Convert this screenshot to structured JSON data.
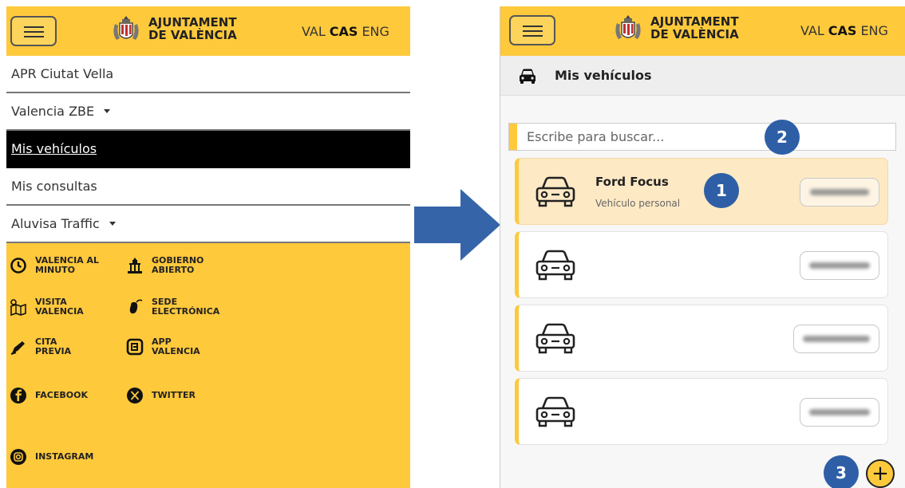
{
  "left": {
    "header": {
      "logo_line1": "AJUNTAMENT",
      "logo_line2": "DE VALÈNCIA",
      "languages": [
        "VAL",
        "CAS",
        "ENG"
      ],
      "active_language": "CAS"
    },
    "menu": [
      {
        "label": "APR Ciutat Vella",
        "dropdown": false,
        "active": false
      },
      {
        "label": "Valencia ZBE",
        "dropdown": true,
        "active": false
      },
      {
        "label": "Mis vehículos",
        "dropdown": false,
        "active": true
      },
      {
        "label": "Mis consultas",
        "dropdown": false,
        "active": false
      },
      {
        "label": "Aluvisa Traffic",
        "dropdown": true,
        "active": false
      }
    ],
    "footer_links": [
      {
        "label": "VALENCIA AL\nMINUTO",
        "icon": "clock-icon"
      },
      {
        "label": "GOBIERNO\nABIERTO",
        "icon": "government-building-icon"
      },
      {
        "label": "VISITA\nVALENCIA",
        "icon": "map-icon"
      },
      {
        "label": "SEDE\nELECTRÓNICA",
        "icon": "mouse-icon"
      },
      {
        "label": "CITA\nPREVIA",
        "icon": "pen-icon"
      },
      {
        "label": "APP\nVALENCIA",
        "icon": "app-icon"
      },
      {
        "label": "FACEBOOK",
        "icon": "facebook-icon"
      },
      {
        "label": "TWITTER",
        "icon": "x-twitter-icon"
      },
      {
        "label": "INSTAGRAM",
        "icon": "instagram-icon"
      }
    ]
  },
  "right": {
    "header": {
      "logo_line1": "AJUNTAMENT",
      "logo_line2": "DE VALÈNCIA",
      "languages": [
        "VAL",
        "CAS",
        "ENG"
      ],
      "active_language": "CAS"
    },
    "section_title": "Mis vehículos",
    "search_placeholder": "Escribe para buscar...",
    "vehicles": [
      {
        "name": "Ford Focus",
        "type": "Vehículo personal",
        "selected": true
      },
      {
        "name": "",
        "type": "",
        "selected": false
      },
      {
        "name": "",
        "type": "",
        "selected": false
      },
      {
        "name": "",
        "type": "",
        "selected": false
      }
    ],
    "add_button": "+"
  },
  "badges": [
    "1",
    "2",
    "3"
  ],
  "colors": {
    "brand_yellow": "#ffc93c",
    "selected_card": "#fde9c4",
    "badge_blue": "#2e5fa6",
    "arrow_blue": "#3565a8"
  }
}
